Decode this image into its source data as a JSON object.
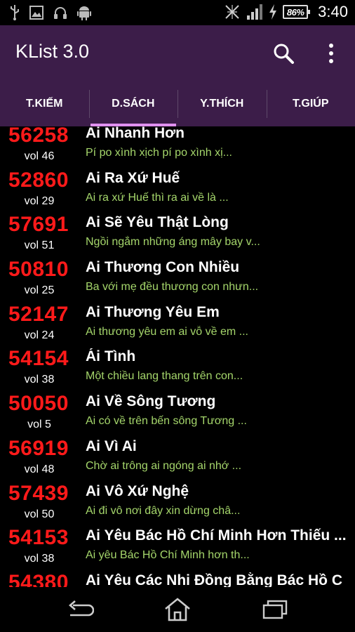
{
  "status_bar": {
    "battery": "86%",
    "time": "3:40",
    "left_icons": [
      "usb-icon",
      "image-icon",
      "headset-icon",
      "android-icon"
    ],
    "right_icons": [
      "no-sim-icon",
      "signal-icon",
      "charging-icon",
      "battery-icon"
    ]
  },
  "app": {
    "title": "KList 3.0",
    "accent_color": "#3c1d49",
    "tab_indicator_color": "#e090f0",
    "number_color": "#ff1a1a",
    "lyric_color": "#a5d66b"
  },
  "tabs": [
    {
      "label": "T.KIẾM",
      "active": false
    },
    {
      "label": "D.SÁCH",
      "active": true
    },
    {
      "label": "Y.THÍCH",
      "active": false
    },
    {
      "label": "T.GIÚP",
      "active": false
    }
  ],
  "songs": [
    {
      "number": "56258",
      "vol": "vol 46",
      "title": "Ai Nhanh Hơn",
      "lyric": "Pí po xình xịch pí po xình xị..."
    },
    {
      "number": "52860",
      "vol": "vol 29",
      "title": "Ai Ra Xứ Huế",
      "lyric": "Ai ra xứ Huế thì ra ai về là ..."
    },
    {
      "number": "57691",
      "vol": "vol 51",
      "title": "Ai Sẽ Yêu Thật Lòng",
      "lyric": "Ngồi ngắm những áng mây bay v..."
    },
    {
      "number": "50810",
      "vol": "vol 25",
      "title": "Ai Thương Con Nhiều",
      "lyric": "Ba với mẹ đều thương con nhưn..."
    },
    {
      "number": "52147",
      "vol": "vol 24",
      "title": "Ai Thương Yêu Em",
      "lyric": "Ai thương yêu em ai vỗ về em ..."
    },
    {
      "number": "54154",
      "vol": "vol 38",
      "title": "Ái Tình",
      "lyric": "Một chiều lang thang trên con..."
    },
    {
      "number": "50050",
      "vol": "vol 5",
      "title": "Ai Về Sông Tương",
      "lyric": "Ai có về trên bến sông Tương ..."
    },
    {
      "number": "56919",
      "vol": "vol 48",
      "title": "Ai Vì Ai",
      "lyric": "Chờ ai trông ai ngóng ai nhớ ..."
    },
    {
      "number": "57439",
      "vol": "vol 50",
      "title": "Ai Vô Xứ Nghệ",
      "lyric": "Ai đi vô nơi đây xin dừng châ..."
    },
    {
      "number": "54153",
      "vol": "vol 38",
      "title": "Ai Yêu Bác Hồ Chí Minh Hơn Thiếu ...",
      "lyric": "Ai yêu Bác Hồ Chí Minh hơn th..."
    },
    {
      "number": "54380",
      "vol": "",
      "title": "Ai Yêu Các Nhi Đồng Bằng Bác Hồ C",
      "lyric": ""
    }
  ]
}
